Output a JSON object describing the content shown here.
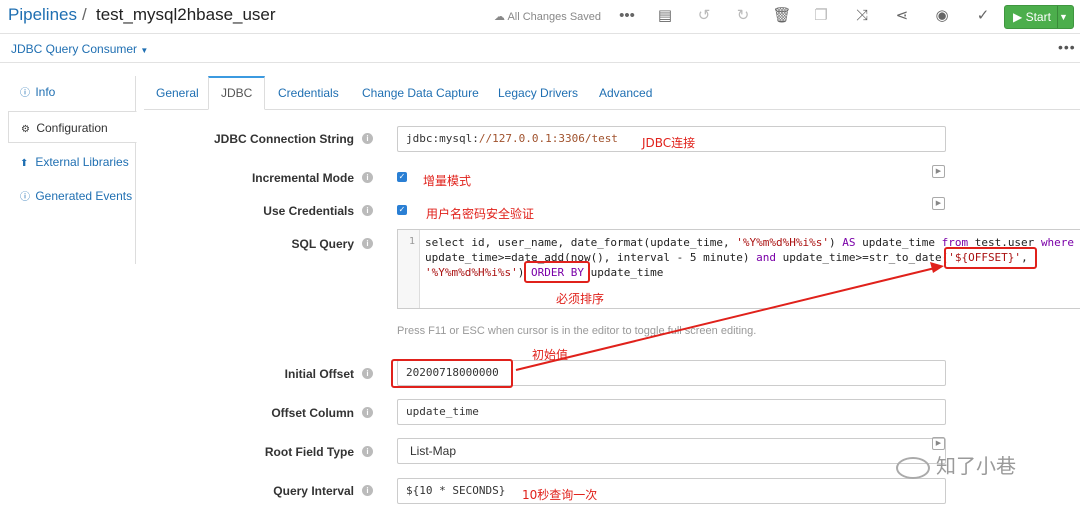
{
  "header": {
    "root": "Pipelines",
    "separator": "/",
    "pipeline_name": "test_mysql2hbase_user",
    "save_status": "All Changes Saved",
    "start_label": "Start"
  },
  "subbar": {
    "stage_name": "JDBC Query Consumer"
  },
  "leftnav": {
    "items": [
      {
        "label": "Info"
      },
      {
        "label": "Configuration"
      },
      {
        "label": "External Libraries"
      },
      {
        "label": "Generated Events"
      }
    ]
  },
  "tabs": [
    {
      "label": "General"
    },
    {
      "label": "JDBC"
    },
    {
      "label": "Credentials"
    },
    {
      "label": "Change Data Capture"
    },
    {
      "label": "Legacy Drivers"
    },
    {
      "label": "Advanced"
    }
  ],
  "form": {
    "conn_label": "JDBC Connection String",
    "conn_prefix": "jdbc:mysql:",
    "conn_path": "//127.0.0.1:3306/test",
    "incremental_label": "Incremental Mode",
    "credentials_label": "Use Credentials",
    "sql_label": "SQL Query",
    "sql_line_no": "1",
    "sql_l1_a": "select id, user_name, date_format(update_time, ",
    "sql_l1_str": "'%Y%m%d%H%i%s'",
    "sql_l1_b": ") ",
    "sql_l1_kw1": "AS",
    "sql_l1_c": " update_time ",
    "sql_l1_kw2": "from",
    "sql_l1_d": " test.user ",
    "sql_l1_kw3": "where",
    "sql_l2_a": "update_time>=date_add(now(), interval - 5 minute) ",
    "sql_l2_kw": "and",
    "sql_l2_b": " update_time>=str_to_date(",
    "sql_l2_str": "'${OFFSET}'",
    "sql_l2_c": ",",
    "sql_l3_str": "'%Y%m%d%H%i%s'",
    "sql_l3_a": ") ",
    "sql_l3_kw": "ORDER BY",
    "sql_l3_b": " update_time",
    "editor_hint": "Press F11 or ESC when cursor is in the editor to toggle full screen editing.",
    "offset_label": "Initial Offset",
    "offset_value": "20200718000000",
    "offset_col_label": "Offset Column",
    "offset_col_value": "update_time",
    "root_type_label": "Root Field Type",
    "root_type_value": "List-Map",
    "interval_label": "Query Interval",
    "interval_value": "${10 * SECONDS}"
  },
  "annotations": {
    "conn": "JDBC连接",
    "incremental": "增量模式",
    "credentials": "用户名密码安全验证",
    "order": "必须排序",
    "offset": "初始值",
    "interval": "10秒查询一次"
  },
  "watermark": "知了小巷",
  "colors": {
    "link": "#1f6fb2",
    "start": "#4cae4c",
    "annotation": "#e0211b"
  }
}
